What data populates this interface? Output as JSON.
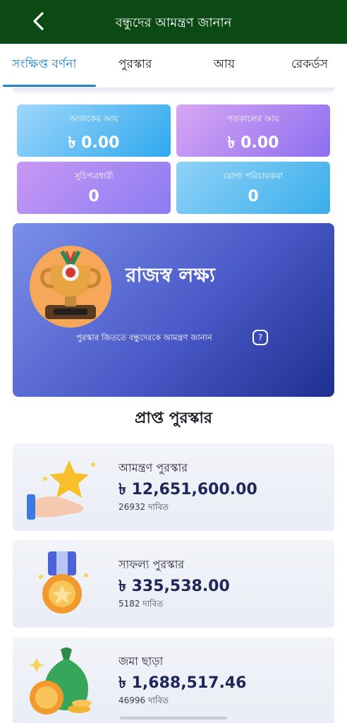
{
  "header": {
    "title": "বন্ধুদের আমন্ত্রণ জানান",
    "back_icon": "chevron-left-icon"
  },
  "tabs": [
    {
      "label": "সংক্ষিপ্ত বর্ণনা",
      "active": true
    },
    {
      "label": "পুরস্কার",
      "active": false
    },
    {
      "label": "আয়",
      "active": false
    },
    {
      "label": "রেকর্ডস",
      "active": false
    }
  ],
  "stats": [
    {
      "label": "আজকের আয়",
      "value": "৳ 0.00"
    },
    {
      "label": "গতকালের আয়",
      "value": "৳ 0.00"
    },
    {
      "label": "সূচিপত্রধারী",
      "value": "0"
    },
    {
      "label": "যোগ্য পরিচায়করা",
      "value": "0"
    }
  ],
  "banner": {
    "title": "রাজস্ব লক্ষ্য",
    "subtitle": "পুরস্কার জিততে বন্ধুদেরকে আমন্ত্রণ জানান",
    "help_symbol": "?"
  },
  "rewards_section_title": "প্রাপ্ত পুরস্কার",
  "rewards": [
    {
      "name": "আমন্ত্রণ পুরস্কার",
      "amount": "৳ 12,651,600.00",
      "claims": "26932 দাবিত",
      "icon": "star-hand-icon"
    },
    {
      "name": "সাফল্য পুরস্কার",
      "amount": "৳ 335,538.00",
      "claims": "5182 দাবিত",
      "icon": "medal-icon"
    },
    {
      "name": "জমা ছাড়া",
      "amount": "৳ 1,688,517.46",
      "claims": "46996 দাবিত",
      "icon": "money-bag-icon"
    }
  ],
  "colors": {
    "header_bg": "#0b4a14",
    "tab_active": "#1c84c8",
    "amount_text": "#1f2659"
  }
}
